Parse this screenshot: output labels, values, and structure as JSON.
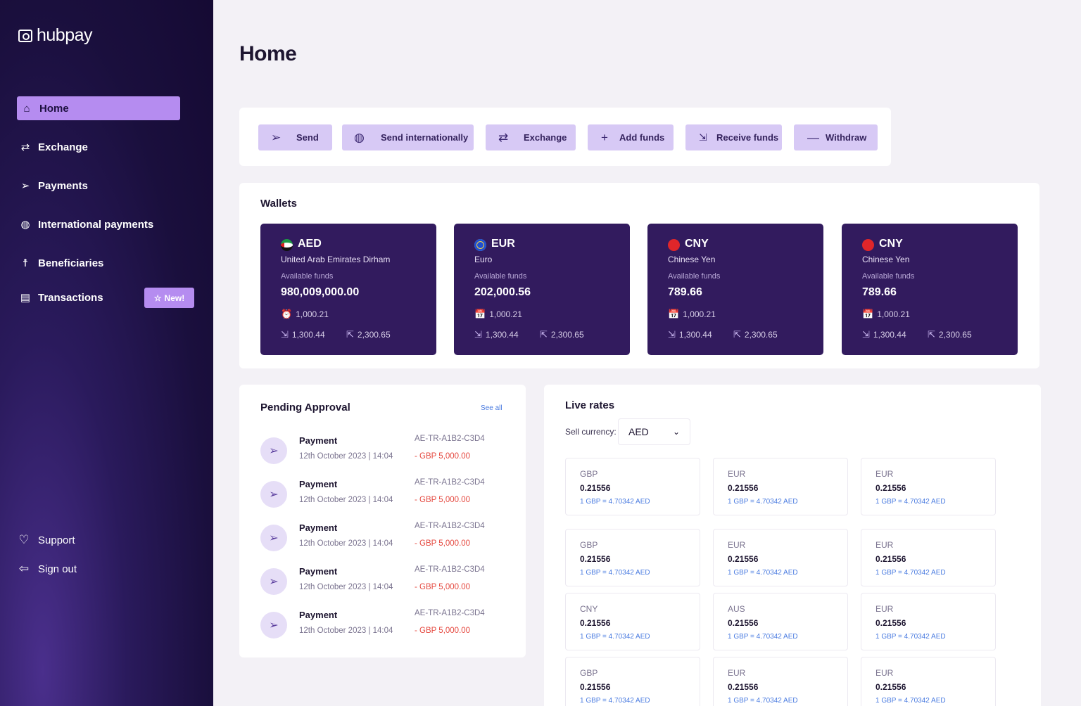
{
  "app": {
    "logo_text": "hubpay"
  },
  "sidebar": {
    "items": [
      {
        "label": "Home",
        "icon": "home-icon"
      },
      {
        "label": "Exchange",
        "icon": "exchange-icon"
      },
      {
        "label": "Payments",
        "icon": "send-icon"
      },
      {
        "label": "International payments",
        "icon": "globe-icon"
      },
      {
        "label": "Beneficiaries",
        "icon": "person-icon"
      },
      {
        "label": "Transactions",
        "icon": "receipt-icon"
      }
    ],
    "new_badge": "New!",
    "footer": [
      {
        "label": "Support",
        "icon": "heart-icon"
      },
      {
        "label": "Sign out",
        "icon": "sign-out-icon"
      }
    ]
  },
  "page": {
    "title": "Home"
  },
  "actions": [
    {
      "label": "Send",
      "icon": "send-icon"
    },
    {
      "label": "Send internationally",
      "icon": "globe-icon"
    },
    {
      "label": "Exchange",
      "icon": "exchange-icon"
    },
    {
      "label": "Add funds",
      "icon": "plus-icon"
    },
    {
      "label": "Receive funds",
      "icon": "receive-icon"
    },
    {
      "label": "Withdraw",
      "icon": "minus-icon"
    }
  ],
  "wallets": {
    "title": "Wallets",
    "items": [
      {
        "code": "AED",
        "name": "United Arab Emirates Dirham",
        "avail_label": "Available funds",
        "amount": "980,009,000.00",
        "scheduled": "1,000.21",
        "incoming": "1,300.44",
        "outgoing": "2,300.65",
        "flag_color": "#1c9a45"
      },
      {
        "code": "EUR",
        "name": "Euro",
        "avail_label": "Available funds",
        "amount": "202,000.56",
        "scheduled": "1,000.21",
        "incoming": "1,300.44",
        "outgoing": "2,300.65",
        "flag_color": "#1f4fd1"
      },
      {
        "code": "CNY",
        "name": "Chinese Yen",
        "avail_label": "Available funds",
        "amount": "789.66",
        "scheduled": "1,000.21",
        "incoming": "1,300.44",
        "outgoing": "2,300.65",
        "flag_color": "#e0262a"
      },
      {
        "code": "CNY",
        "name": "Chinese Yen",
        "avail_label": "Available funds",
        "amount": "789.66",
        "scheduled": "1,000.21",
        "incoming": "1,300.44",
        "outgoing": "2,300.65",
        "flag_color": "#e0262a"
      }
    ]
  },
  "pending": {
    "title": "Pending Approval",
    "see_all": "See all",
    "items": [
      {
        "title": "Payment",
        "date": "12th October 2023 | 14:04",
        "ref": "AE-TR-A1B2-C3D4",
        "amount": "- GBP 5,000.00"
      },
      {
        "title": "Payment",
        "date": "12th October 2023 | 14:04",
        "ref": "AE-TR-A1B2-C3D4",
        "amount": "- GBP 5,000.00"
      },
      {
        "title": "Payment",
        "date": "12th October 2023 | 14:04",
        "ref": "AE-TR-A1B2-C3D4",
        "amount": "- GBP 5,000.00"
      },
      {
        "title": "Payment",
        "date": "12th October 2023 | 14:04",
        "ref": "AE-TR-A1B2-C3D4",
        "amount": "- GBP 5,000.00"
      },
      {
        "title": "Payment",
        "date": "12th October 2023 | 14:04",
        "ref": "AE-TR-A1B2-C3D4",
        "amount": "- GBP 5,000.00"
      }
    ]
  },
  "rates": {
    "title": "Live rates",
    "sell_label": "Sell currency:",
    "sell_value": "AED",
    "items": [
      {
        "code": "GBP",
        "value": "0.21556",
        "note": "1 GBP = 4.70342 AED"
      },
      {
        "code": "EUR",
        "value": "0.21556",
        "note": "1 GBP = 4.70342 AED"
      },
      {
        "code": "EUR",
        "value": "0.21556",
        "note": "1 GBP = 4.70342 AED"
      },
      {
        "code": "GBP",
        "value": "0.21556",
        "note": "1 GBP = 4.70342 AED"
      },
      {
        "code": "EUR",
        "value": "0.21556",
        "note": "1 GBP = 4.70342 AED"
      },
      {
        "code": "EUR",
        "value": "0.21556",
        "note": "1 GBP = 4.70342 AED"
      },
      {
        "code": "CNY",
        "value": "0.21556",
        "note": "1 GBP = 4.70342 AED"
      },
      {
        "code": "AUS",
        "value": "0.21556",
        "note": "1 GBP = 4.70342 AED"
      },
      {
        "code": "EUR",
        "value": "0.21556",
        "note": "1 GBP = 4.70342 AED"
      },
      {
        "code": "GBP",
        "value": "0.21556",
        "note": "1 GBP = 4.70342 AED"
      },
      {
        "code": "EUR",
        "value": "0.21556",
        "note": "1 GBP = 4.70342 AED"
      },
      {
        "code": "EUR",
        "value": "0.21556",
        "note": "1 GBP = 4.70342 AED"
      }
    ]
  }
}
